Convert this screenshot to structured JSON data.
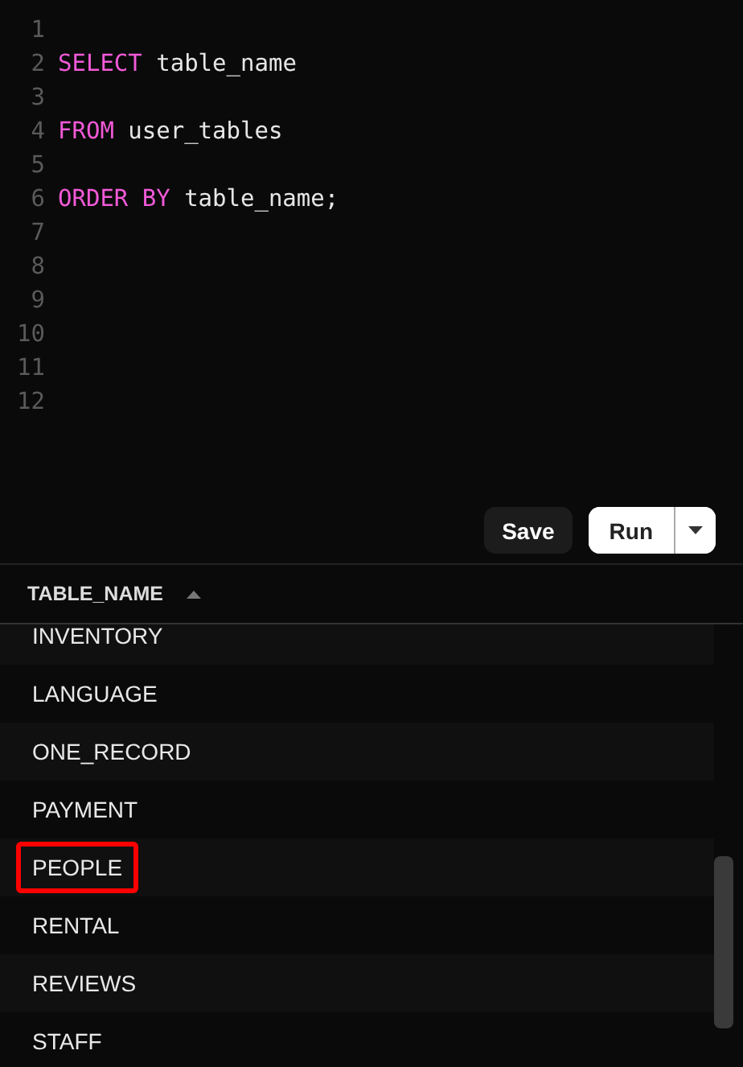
{
  "editor": {
    "lines": [
      {
        "number": "1"
      },
      {
        "number": "2",
        "tokens": [
          {
            "text": "SELECT",
            "kind": "keyword"
          },
          {
            "text": " table_name",
            "kind": "identifier"
          }
        ]
      },
      {
        "number": "3"
      },
      {
        "number": "4",
        "tokens": [
          {
            "text": "FROM",
            "kind": "keyword"
          },
          {
            "text": " user_tables",
            "kind": "identifier"
          }
        ]
      },
      {
        "number": "5"
      },
      {
        "number": "6",
        "tokens": [
          {
            "text": "ORDER BY",
            "kind": "keyword"
          },
          {
            "text": " table_name;",
            "kind": "identifier"
          }
        ]
      },
      {
        "number": "7"
      },
      {
        "number": "8"
      },
      {
        "number": "9"
      },
      {
        "number": "10"
      },
      {
        "number": "11"
      },
      {
        "number": "12"
      }
    ]
  },
  "toolbar": {
    "save": "Save",
    "run": "Run"
  },
  "results": {
    "columns": [
      {
        "label": "TABLE_NAME",
        "sorted_ascending": true
      }
    ],
    "rows": [
      {
        "name": "INVENTORY",
        "highlighted": false
      },
      {
        "name": "LANGUAGE",
        "highlighted": false
      },
      {
        "name": "ONE_RECORD",
        "highlighted": false
      },
      {
        "name": "PAYMENT",
        "highlighted": false
      },
      {
        "name": "PEOPLE",
        "highlighted": true
      },
      {
        "name": "RENTAL",
        "highlighted": false
      },
      {
        "name": "REVIEWS",
        "highlighted": false
      },
      {
        "name": "STAFF",
        "highlighted": false
      }
    ]
  }
}
